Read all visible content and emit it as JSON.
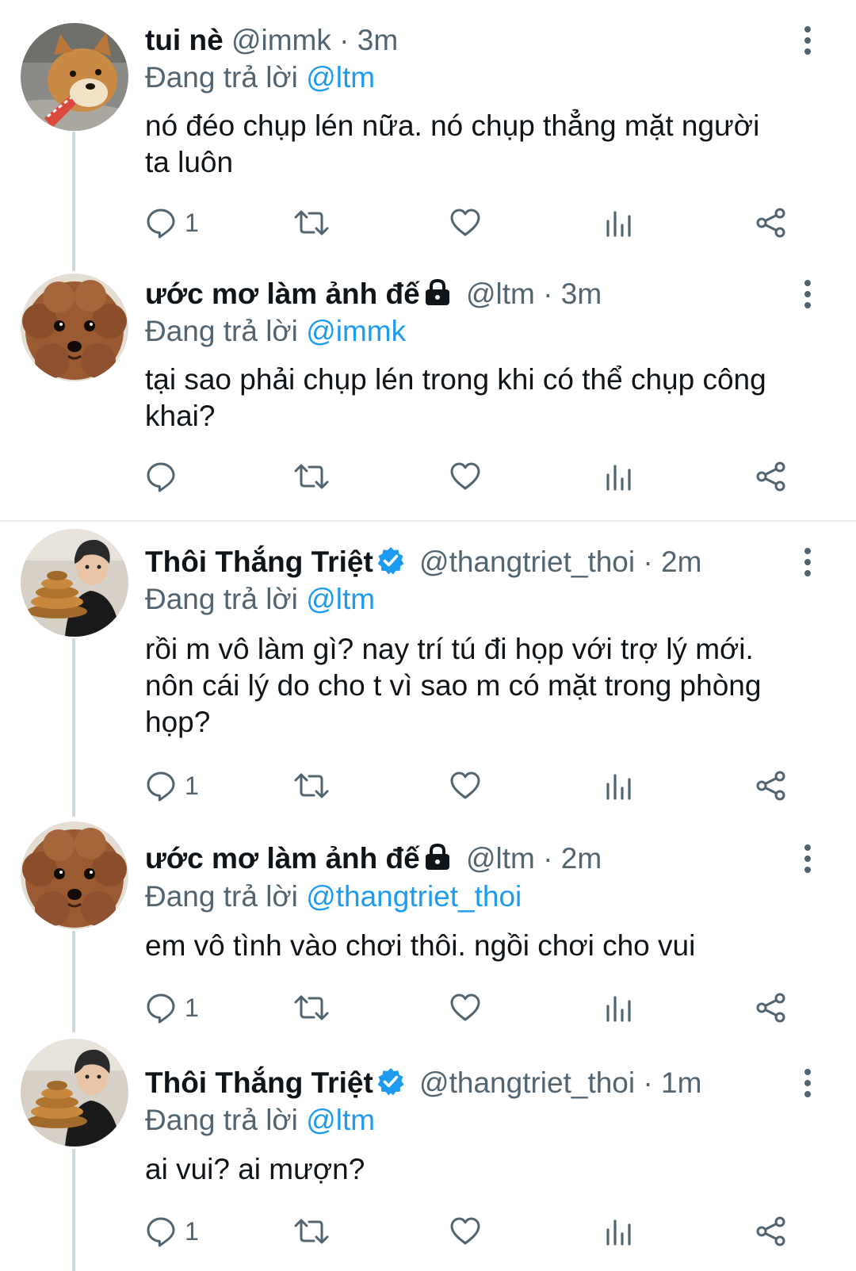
{
  "reply_prefix": "Đang trả lời",
  "tweets": [
    {
      "name": "tui nè",
      "handle": "@immk",
      "dot": "·",
      "time": "3m",
      "reply_to": "@ltm",
      "lines": [
        "nó đéo chụp lén nữa. nó chụp thẳng mặt người",
        "ta luôn"
      ],
      "reply_count": "1",
      "avatar": "shiba-dog",
      "badge": "none"
    },
    {
      "name": "ước mơ làm ảnh đế",
      "handle": "@ltm",
      "dot": "·",
      "time": "3m",
      "reply_to": "@immk",
      "lines": [
        "tại sao phải chụp lén trong khi có thể chụp công",
        "khai?"
      ],
      "reply_count": "",
      "avatar": "poodle-dog",
      "badge": "lock-icon"
    },
    {
      "name": "Thôi Thắng Triệt",
      "handle": "@thangtriet_thoi",
      "dot": "·",
      "time": "2m",
      "reply_to": "@ltm",
      "lines": [
        "rồi m vô làm gì? nay trí tú đi họp với trợ lý mới.",
        "nôn cái lý do cho t vì sao m có mặt trong phòng",
        "họp?"
      ],
      "reply_count": "1",
      "avatar": "man-with-cake",
      "badge": "verified-icon"
    },
    {
      "name": "ước mơ làm ảnh đế",
      "handle": "@ltm",
      "dot": "·",
      "time": "2m",
      "reply_to": "@thangtriet_thoi",
      "lines": [
        "em vô tình vào chơi thôi. ngồi chơi cho vui"
      ],
      "reply_count": "1",
      "avatar": "poodle-dog",
      "badge": "lock-icon"
    },
    {
      "name": "Thôi Thắng Triệt",
      "handle": "@thangtriet_thoi",
      "dot": "·",
      "time": "1m",
      "reply_to": "@ltm",
      "lines": [
        "ai vui? ai mượn?"
      ],
      "reply_count": "1",
      "avatar": "man-with-cake",
      "badge": "verified-icon"
    }
  ],
  "colors": {
    "text": "#0f1419",
    "secondary": "#536471",
    "accent": "#1d9bf0",
    "thread_line": "#cfd9de",
    "divider": "#e6ecf0"
  },
  "icons": [
    "reply-icon",
    "retweet-icon",
    "like-icon",
    "analytics-icon",
    "share-icon",
    "more-icon",
    "lock-icon",
    "verified-icon"
  ]
}
